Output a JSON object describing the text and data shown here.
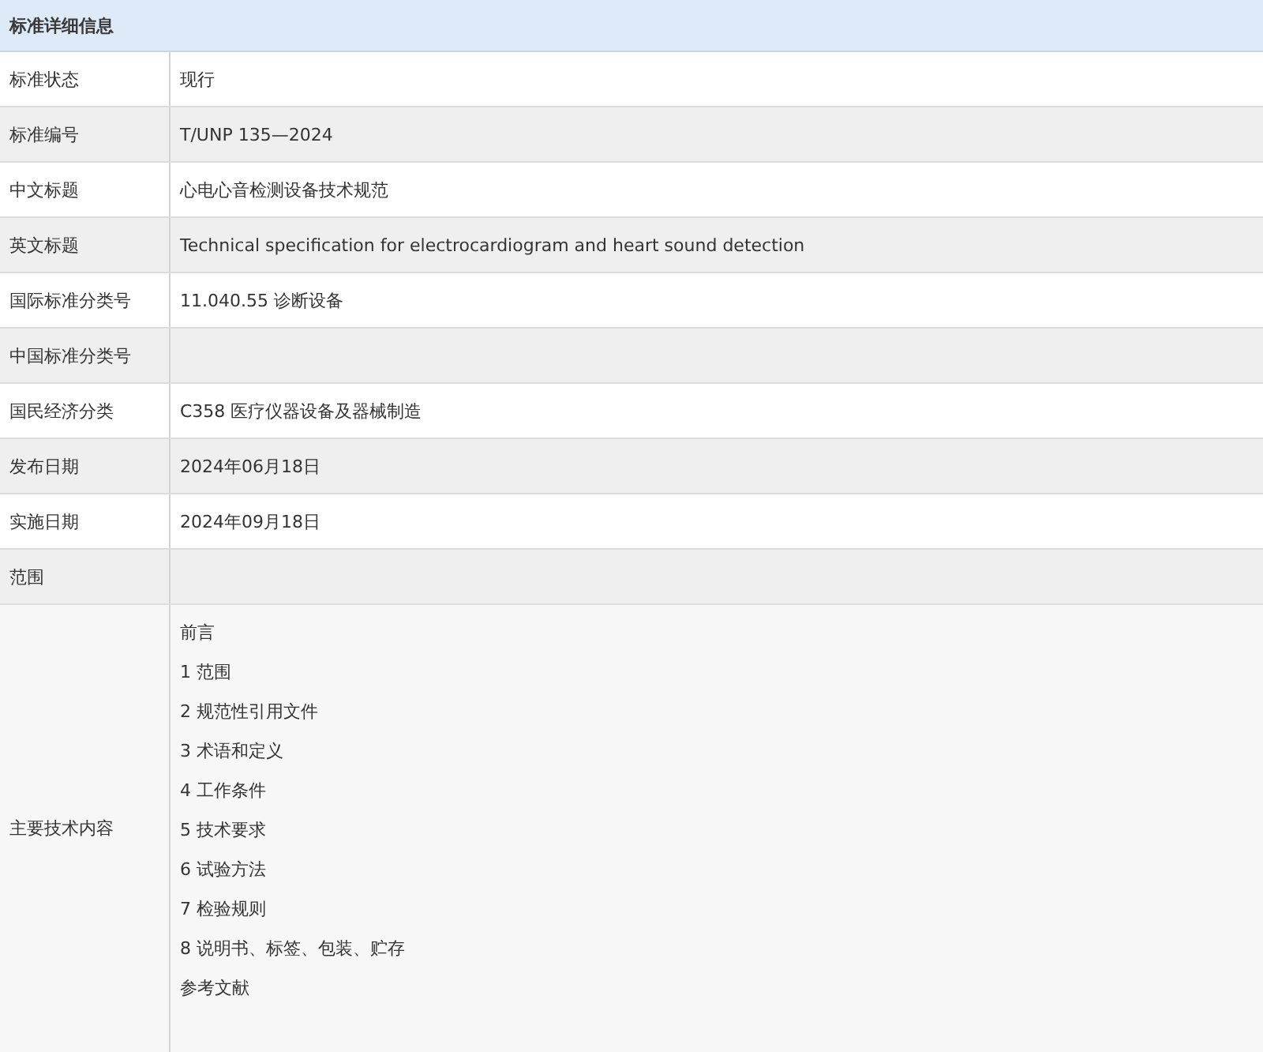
{
  "header": {
    "title": "标准详细信息"
  },
  "rows": [
    {
      "label": "标准状态",
      "value": "现行"
    },
    {
      "label": "标准编号",
      "value": "T/UNP 135—2024"
    },
    {
      "label": "中文标题",
      "value": "心电心音检测设备技术规范"
    },
    {
      "label": "英文标题",
      "value": "Technical specification for electrocardiogram and heart sound detection"
    },
    {
      "label": "国际标准分类号",
      "value": "11.040.55 诊断设备"
    },
    {
      "label": "中国标准分类号"
    },
    {
      "label": "国民经济分类",
      "value": "C358 医疗仪器设备及器械制造"
    },
    {
      "label": "发布日期",
      "value": "2024年06月18日"
    },
    {
      "label": "实施日期",
      "value": "2024年09月18日"
    },
    {
      "label": "范围"
    }
  ],
  "contents": {
    "label": "主要技术内容",
    "items": [
      "前言",
      "1  范围",
      "2  规范性引用文件",
      "3  术语和定义",
      "4  工作条件",
      "5  技术要求",
      "6  试验方法",
      "7  检验规则",
      "8  说明书、标签、包装、贮存",
      "参考文献"
    ]
  }
}
